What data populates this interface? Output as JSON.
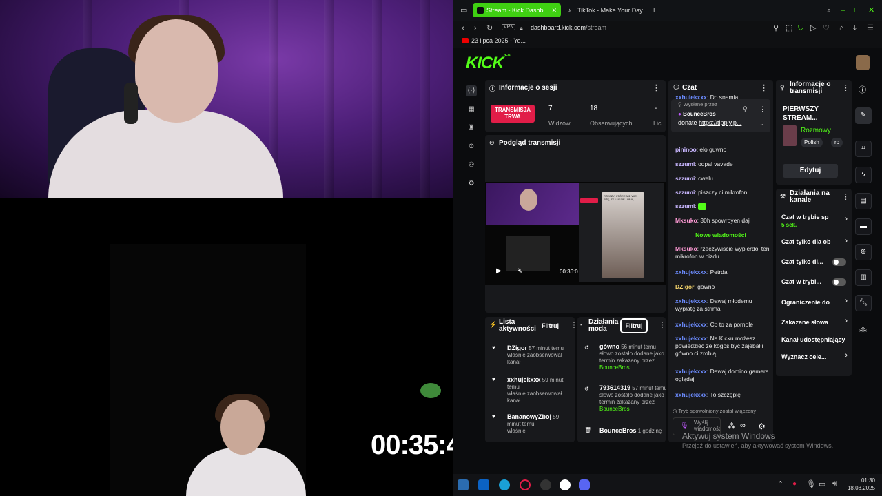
{
  "overlay": {
    "timer": "00:35:45"
  },
  "browser": {
    "tabs": [
      {
        "label": "Stream - Kick Dashb",
        "active": true
      },
      {
        "label": "TikTok - Make Your Day",
        "active": false
      }
    ],
    "url_domain": "dashboard.kick.com",
    "url_path": "/stream",
    "vpn_label": "VPN",
    "bookmark": "23 lipca 2025 - Yo..."
  },
  "kick": {
    "logo": "KICK",
    "logo_badge": "BETA",
    "session": {
      "title": "Informacje o sesji",
      "live_badge": "TRANSMISJA TRWA",
      "viewers_value": "7",
      "viewers_label": "Widzów",
      "followers_value": "18",
      "followers_label": "Obserwujących",
      "extra_value": "-",
      "extra_label": "Lic"
    },
    "preview": {
      "title": "Podgląd transmisji",
      "time": "00:36:0",
      "tiktok_caption": "RZECZY, KTÓRE NIE WIE-RZĘ, ŻE LUDZIE LUBIĄ"
    },
    "activity": {
      "title": "Lista aktywności",
      "filter": "Filtruj",
      "items": [
        {
          "name": "DZigor",
          "time": "57 minut temu",
          "text": "właśnie zaobserwował kanał"
        },
        {
          "name": "xxhujekxxx",
          "time": "59 minut temu",
          "text": "właśnie zaobserwował kanał"
        },
        {
          "name": "BananowyZboj",
          "time": "59 minut temu",
          "text": "właśnie"
        }
      ]
    },
    "modactions": {
      "title": "Działania moda",
      "filter": "Filtruj",
      "items": [
        {
          "name": "gówno",
          "time": "56 minut temu",
          "text": "słowo zostało dodane jako termin zakazany przez",
          "by": "BounceBros"
        },
        {
          "name": "793614319",
          "time": "57 minut temu",
          "text": "słowo zostało dodane jako termin zakazany przez",
          "by": "BounceBros"
        },
        {
          "name": "BounceBros",
          "time": "1 godzinę"
        }
      ]
    },
    "chat": {
      "title": "Czat",
      "top_user": "xxhujekxxx",
      "top_text": "Do spamia",
      "pinned_label": "Wysłane przez",
      "pinned_user": "BounceBros",
      "pinned_text": "donate",
      "pinned_link": "https://tipply.p...",
      "new_messages": "Nowe wiadomości",
      "messages": [
        {
          "user": "pininoo",
          "text": "elo guwno",
          "color": "pur"
        },
        {
          "user": "szzumi",
          "text": "odpal vavade",
          "color": "pur"
        },
        {
          "user": "szzumi",
          "text": "cwelu",
          "color": "pur"
        },
        {
          "user": "szzumi",
          "text": "piszczy ci mikrofon",
          "color": "pur"
        },
        {
          "user": "szzumi",
          "text": "",
          "color": "pur"
        },
        {
          "user": "Mksuko",
          "text": "30h spowroyen daj",
          "color": "pink"
        },
        {
          "user": "Mksuko",
          "text": "rzeczywiście wypierdol ten mikrofon w pizdu",
          "color": "pink"
        },
        {
          "user": "xxhujekxxx",
          "text": "Petrda",
          "color": "blue"
        },
        {
          "user": "DZigor",
          "text": "gówno",
          "color": "yel"
        },
        {
          "user": "xxhujekxxx",
          "text": "Dawaj młodemu wypłatę za strima",
          "color": "blue"
        },
        {
          "user": "xxhujekxxx",
          "text": "Co to za pornole",
          "color": "blue"
        },
        {
          "user": "xxhujekxxx",
          "text": "Na Kicku możesz powiedzieć że kogoś być zajebał i gówno ci zrobią",
          "color": "blue"
        },
        {
          "user": "xxhujekxxx",
          "text": "Dawaj domino gamera oglądaj",
          "color": "blue"
        },
        {
          "user": "xxhujekxxx",
          "text": "To szczęplę",
          "color": "blue"
        }
      ],
      "slowmode_notice": "Tryb spowolniony został włączony",
      "send_placeholder": "Wyślij wiadomość"
    },
    "streaminfo": {
      "title": "Informacje o transmisji",
      "stream_title": "PIERWSZY STREAM...",
      "category": "Rozmowy",
      "tags": [
        "Polish",
        "ro"
      ],
      "edit_button": "Edytuj"
    },
    "channel_actions": {
      "title": "Działania na kanale",
      "items": [
        {
          "label": "Czat w trybie sp",
          "sub": "5 sek.",
          "control": "chevron"
        },
        {
          "label": "Czat tylko dla ob",
          "control": "chevron"
        },
        {
          "label": "Czat tylko dl...",
          "control": "toggle"
        },
        {
          "label": "Czat w trybi...",
          "control": "toggle"
        },
        {
          "label": "Ograniczenie do",
          "control": "chevron"
        },
        {
          "label": "Zakazane słowa",
          "control": "chevron"
        },
        {
          "label": "Kanał udostępniający",
          "control": "none"
        },
        {
          "label": "Wyznacz cele...",
          "control": "chevron"
        }
      ]
    }
  },
  "windows": {
    "watermark_title": "Aktywuj system Windows",
    "watermark_sub": "Przejdź do ustawień, aby aktywować system Windows.",
    "clock_time": "01:30",
    "clock_date": "18.08.2025"
  },
  "colors": {
    "accent": "#53fc18",
    "live": "#e11d48",
    "panel": "#18191c"
  }
}
